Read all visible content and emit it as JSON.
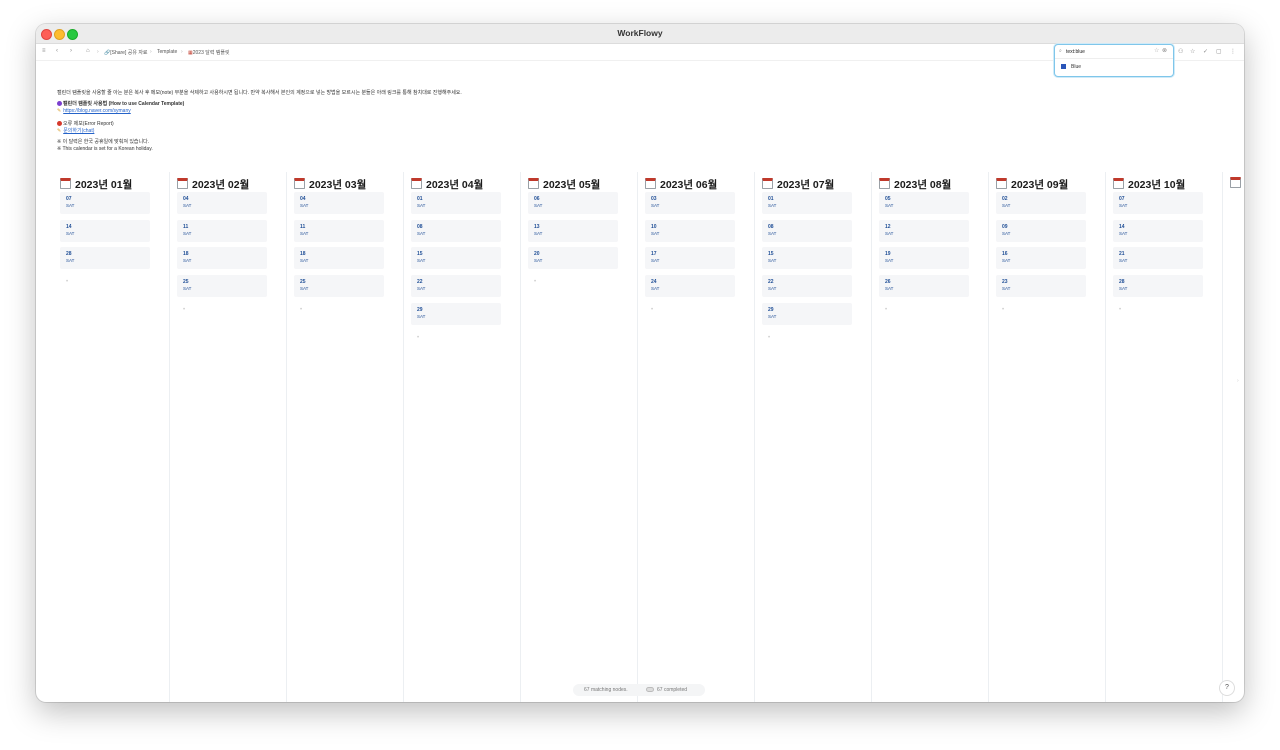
{
  "window": {
    "title": "WorkFlowy"
  },
  "toolbar": {
    "breadcrumbs": [
      "[Share] 공유 자료",
      "Template",
      "2023 달력 템플릿"
    ],
    "search": {
      "query": "text:blue",
      "suggestion": "Blue",
      "suggestion_color": "#2a55b8"
    }
  },
  "intro": {
    "line1": "캘린더 템플릿을 사용할 줄 아는 분은 복사 후 메모(note) 부분을 삭제하고 사용하시면 됩니다. 만약 복사해서 본인의 계정으로 넣는 방법을 모르시는 분들은 아래 링크를 통해 참치대로 진행해주세요.",
    "howto_title": "캘린더 템플릿 사용법 (How to use Calendar Template)",
    "howto_link": "https://blog.naver.com/symany",
    "report_title": "오류 제보(Error Report)",
    "report_link": "문의하기(chat)",
    "note_kr": "※ 이 달력은 한국 공휴일에 맞춰져 있습니다.",
    "note_en": "※ This calendar is set for a Korean holiday."
  },
  "months": [
    {
      "title": "2023년 01월",
      "days": [
        {
          "date": "07",
          "dow": "SAT"
        },
        {
          "date": "14",
          "dow": "SAT"
        },
        {
          "date": "28",
          "dow": "SAT"
        }
      ]
    },
    {
      "title": "2023년 02월",
      "days": [
        {
          "date": "04",
          "dow": "SAT"
        },
        {
          "date": "11",
          "dow": "SAT"
        },
        {
          "date": "18",
          "dow": "SAT"
        },
        {
          "date": "25",
          "dow": "SAT"
        }
      ]
    },
    {
      "title": "2023년 03월",
      "days": [
        {
          "date": "04",
          "dow": "SAT"
        },
        {
          "date": "11",
          "dow": "SAT"
        },
        {
          "date": "18",
          "dow": "SAT"
        },
        {
          "date": "25",
          "dow": "SAT"
        }
      ]
    },
    {
      "title": "2023년 04월",
      "days": [
        {
          "date": "01",
          "dow": "SAT"
        },
        {
          "date": "08",
          "dow": "SAT"
        },
        {
          "date": "15",
          "dow": "SAT"
        },
        {
          "date": "22",
          "dow": "SAT"
        },
        {
          "date": "29",
          "dow": "SAT"
        }
      ]
    },
    {
      "title": "2023년 05월",
      "days": [
        {
          "date": "06",
          "dow": "SAT"
        },
        {
          "date": "13",
          "dow": "SAT"
        },
        {
          "date": "20",
          "dow": "SAT"
        }
      ]
    },
    {
      "title": "2023년 06월",
      "days": [
        {
          "date": "03",
          "dow": "SAT"
        },
        {
          "date": "10",
          "dow": "SAT"
        },
        {
          "date": "17",
          "dow": "SAT"
        },
        {
          "date": "24",
          "dow": "SAT"
        }
      ]
    },
    {
      "title": "2023년 07월",
      "days": [
        {
          "date": "01",
          "dow": "SAT"
        },
        {
          "date": "08",
          "dow": "SAT"
        },
        {
          "date": "15",
          "dow": "SAT"
        },
        {
          "date": "22",
          "dow": "SAT"
        },
        {
          "date": "29",
          "dow": "SAT"
        }
      ]
    },
    {
      "title": "2023년 08월",
      "days": [
        {
          "date": "05",
          "dow": "SAT"
        },
        {
          "date": "12",
          "dow": "SAT"
        },
        {
          "date": "19",
          "dow": "SAT"
        },
        {
          "date": "26",
          "dow": "SAT"
        }
      ]
    },
    {
      "title": "2023년 09월",
      "days": [
        {
          "date": "02",
          "dow": "SAT"
        },
        {
          "date": "09",
          "dow": "SAT"
        },
        {
          "date": "16",
          "dow": "SAT"
        },
        {
          "date": "23",
          "dow": "SAT"
        }
      ]
    },
    {
      "title": "2023년 10월",
      "days": [
        {
          "date": "07",
          "dow": "SAT"
        },
        {
          "date": "14",
          "dow": "SAT"
        },
        {
          "date": "21",
          "dow": "SAT"
        },
        {
          "date": "28",
          "dow": "SAT"
        }
      ]
    }
  ],
  "status": {
    "matching": "67 matching nodes.",
    "completed": "67 completed"
  },
  "help_label": "?"
}
